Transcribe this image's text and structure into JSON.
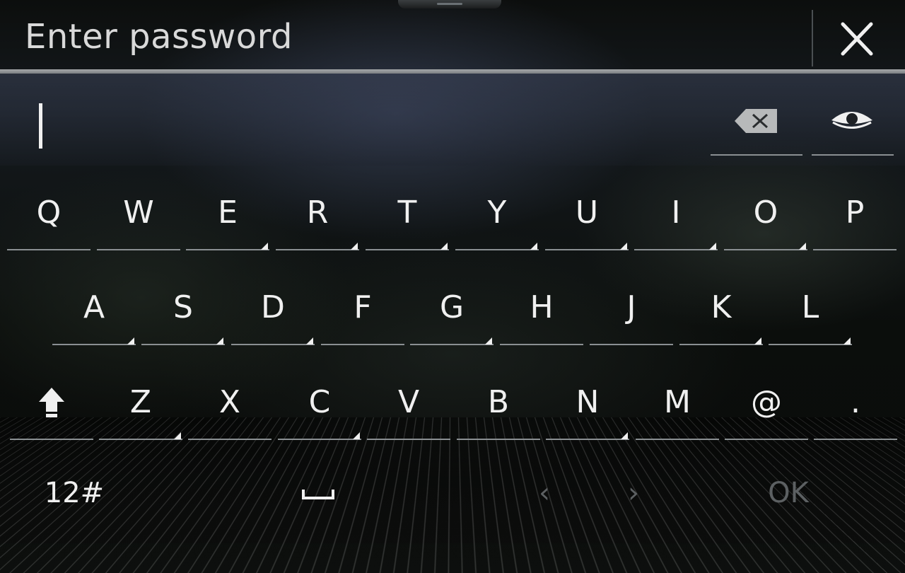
{
  "title": "Enter password",
  "keyboard": {
    "row1": [
      "Q",
      "W",
      "E",
      "R",
      "T",
      "Y",
      "U",
      "I",
      "O",
      "P"
    ],
    "row2": [
      "A",
      "S",
      "D",
      "F",
      "G",
      "H",
      "J",
      "K",
      "L"
    ],
    "row3": [
      "Z",
      "X",
      "C",
      "V",
      "B",
      "N",
      "M",
      "@",
      "."
    ],
    "mode_label": "12#",
    "prev_label": "‹",
    "next_label": "›",
    "ok_label": "OK"
  },
  "icons": {
    "close": "close-icon",
    "backspace": "backspace-icon",
    "show_password": "eye-icon",
    "shift": "shift-icon",
    "space": "space-icon"
  }
}
